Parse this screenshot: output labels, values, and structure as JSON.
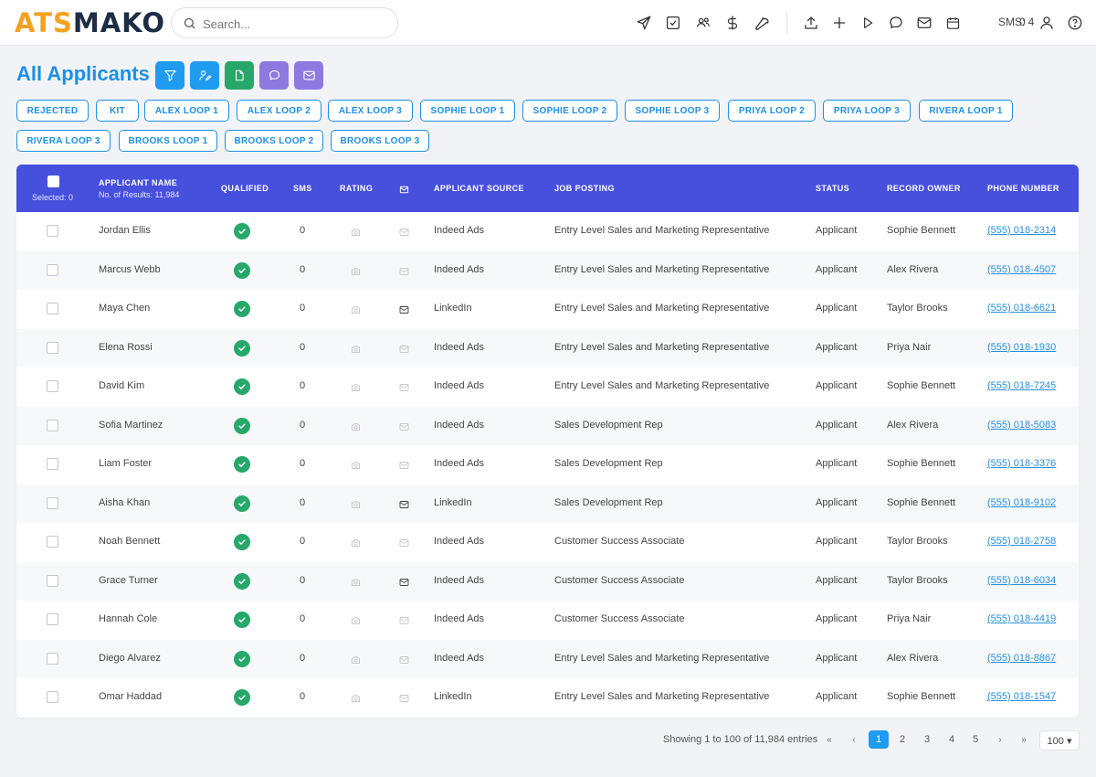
{
  "app": {
    "logo_part1": "ATS",
    "logo_part2": "MAKO",
    "search_placeholder": "Search...",
    "sms_label": "SMS: 4",
    "notification_count": "0"
  },
  "page": {
    "title": "All Applicants"
  },
  "chips": [
    "REJECTED",
    "KIT",
    "ALEX LOOP 1",
    "ALEX LOOP 2",
    "ALEX LOOP 3",
    "SOPHIE LOOP 1",
    "SOPHIE LOOP 2",
    "SOPHIE LOOP 3",
    "PRIYA LOOP 2",
    "PRIYA LOOP 3",
    "RIVERA LOOP 1",
    "RIVERA LOOP 3",
    "BROOKS LOOP 1",
    "BROOKS LOOP 2",
    "BROOKS LOOP 3"
  ],
  "table": {
    "selected_label": "Selected: 0",
    "col_name": "APPLICANT NAME",
    "results_label": "No. of Results: 11,984",
    "col_qualified": "QUALIFIED",
    "col_sms": "SMS",
    "col_rating": "RATING",
    "col_source": "APPLICANT SOURCE",
    "col_job": "JOB POSTING",
    "col_status": "STATUS",
    "col_owner": "RECORD OWNER",
    "col_phone": "PHONE NUMBER",
    "rows": [
      {
        "name": "Jordan Ellis",
        "sms": "0",
        "mail_active": false,
        "source": "Indeed Ads",
        "job": "Entry Level Sales and Marketing Representative",
        "status": "Applicant",
        "owner": "Sophie Bennett",
        "phone": "(555) 018-2314"
      },
      {
        "name": "Marcus Webb",
        "sms": "0",
        "mail_active": false,
        "source": "Indeed Ads",
        "job": "Entry Level Sales and Marketing Representative",
        "status": "Applicant",
        "owner": "Alex Rivera",
        "phone": "(555) 018-4507"
      },
      {
        "name": "Maya Chen",
        "sms": "0",
        "mail_active": true,
        "source": "LinkedIn",
        "job": "Entry Level Sales and Marketing Representative",
        "status": "Applicant",
        "owner": "Taylor Brooks",
        "phone": "(555) 018-6621"
      },
      {
        "name": "Elena Rossi",
        "sms": "0",
        "mail_active": false,
        "source": "Indeed Ads",
        "job": "Entry Level Sales and Marketing Representative",
        "status": "Applicant",
        "owner": "Priya Nair",
        "phone": "(555) 018-1930"
      },
      {
        "name": "David Kim",
        "sms": "0",
        "mail_active": false,
        "source": "Indeed Ads",
        "job": "Entry Level Sales and Marketing Representative",
        "status": "Applicant",
        "owner": "Sophie Bennett",
        "phone": "(555) 018-7245"
      },
      {
        "name": "Sofia Martinez",
        "sms": "0",
        "mail_active": false,
        "source": "Indeed Ads",
        "job": "Sales Development Rep",
        "status": "Applicant",
        "owner": "Alex Rivera",
        "phone": "(555) 018-5083"
      },
      {
        "name": "Liam Foster",
        "sms": "0",
        "mail_active": false,
        "source": "Indeed Ads",
        "job": "Sales Development Rep",
        "status": "Applicant",
        "owner": "Sophie Bennett",
        "phone": "(555) 018-3376"
      },
      {
        "name": "Aisha Khan",
        "sms": "0",
        "mail_active": true,
        "source": "LinkedIn",
        "job": "Sales Development Rep",
        "status": "Applicant",
        "owner": "Sophie Bennett",
        "phone": "(555) 018-9102"
      },
      {
        "name": "Noah Bennett",
        "sms": "0",
        "mail_active": false,
        "source": "Indeed Ads",
        "job": "Customer Success Associate",
        "status": "Applicant",
        "owner": "Taylor Brooks",
        "phone": "(555) 018-2758"
      },
      {
        "name": "Grace Turner",
        "sms": "0",
        "mail_active": true,
        "source": "Indeed Ads",
        "job": "Customer Success Associate",
        "status": "Applicant",
        "owner": "Taylor Brooks",
        "phone": "(555) 018-6034"
      },
      {
        "name": "Hannah Cole",
        "sms": "0",
        "mail_active": false,
        "source": "Indeed Ads",
        "job": "Customer Success Associate",
        "status": "Applicant",
        "owner": "Priya Nair",
        "phone": "(555) 018-4419"
      },
      {
        "name": "Diego Alvarez",
        "sms": "0",
        "mail_active": false,
        "source": "Indeed Ads",
        "job": "Entry Level Sales and Marketing Representative",
        "status": "Applicant",
        "owner": "Alex Rivera",
        "phone": "(555) 018-8867"
      },
      {
        "name": "Omar Haddad",
        "sms": "0",
        "mail_active": false,
        "source": "LinkedIn",
        "job": "Entry Level Sales and Marketing Representative",
        "status": "Applicant",
        "owner": "Sophie Bennett",
        "phone": "(555) 018-1547"
      }
    ]
  },
  "pagination": {
    "info": "Showing 1 to 100 of 11,984 entries",
    "first": "«",
    "prev": "‹",
    "pages": [
      "1",
      "2",
      "3",
      "4",
      "5"
    ],
    "next": "›",
    "last": "»",
    "page_size": "100 ▾"
  },
  "colors": {
    "accent": "#1e8fe6",
    "header_bg": "#4750dd",
    "success": "#27a86a",
    "purple": "#8d79e0"
  }
}
